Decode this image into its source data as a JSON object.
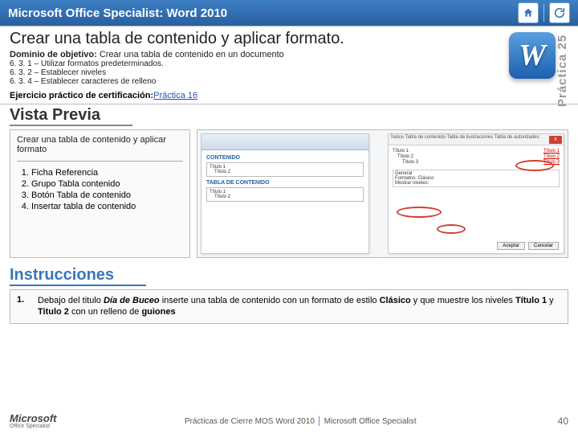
{
  "header": {
    "title": "Microsoft Office Specialist: Word 2010"
  },
  "side_label": "Práctica 25",
  "word_glyph": "W",
  "lesson": {
    "title": "Crear una tabla de contenido y aplicar formato.",
    "objective_label": "Dominio de objetivo:",
    "objective_text": " Crear una tabla de contenido en un documento",
    "sub": [
      "6. 3. 1 – Utilizar formatos predeterminados.",
      "6. 3. 2 – Establecer niveles",
      "6. 3. 4 – Establecer caracteres de relleno"
    ],
    "cert_label": "Ejercicio práctico de certificación:",
    "cert_link": "Práctica 16"
  },
  "preview": {
    "title": "Vista Previa",
    "left_heading": "Crear una tabla de contenido y aplicar formato",
    "steps": [
      "Ficha Referencia",
      "Grupo Tabla contenido",
      "Botón Tabla de contenido",
      "Insertar tabla de contenido"
    ],
    "mini_doc": {
      "contenido": "CONTENIDO",
      "t1": "Título 1",
      "t2": "Título 2",
      "tabla": "TABLA DE CONTENIDO"
    },
    "dialog": {
      "tabbar": "Índice   Tabla de contenido   Tabla de ilustraciones   Tabla de autoridades",
      "t1a": "Título 1",
      "t1b": "Título 1",
      "t2a": "Título 2",
      "t2b": "Título 2",
      "t3a": "Título 3",
      "t3b": "Título 3",
      "general": "General",
      "formatos": "Formatos:",
      "clasico": "Clásico",
      "niveles": "Mostrar niveles:",
      "btn_ok": "Aceptar",
      "btn_cancel": "Cancelar",
      "close": "x"
    }
  },
  "instructions": {
    "title": "Instrucciones",
    "items": [
      {
        "num": "1.",
        "html": "Debajo del titulo <i>Día de Buceo</i> inserte una tabla de contenido con un formato de estilo <b>Clásico</b> y que muestre los niveles <b>Título 1</b> y <b>Titulo 2</b> con un relleno de <b>guiones</b>"
      }
    ]
  },
  "footer": {
    "logo_main": "Microsoft",
    "logo_sub": "Office Specialist",
    "center_left": "Prácticas de Cierre MOS Word 2010 ",
    "center_right": " Microsoft Office Specialist",
    "page": "40"
  }
}
